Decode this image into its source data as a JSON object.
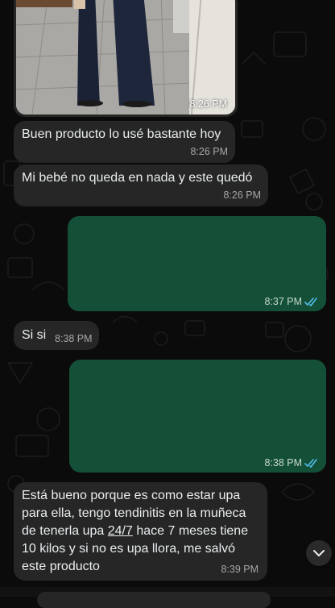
{
  "chat": {
    "photo_message": {
      "time": "8:26 PM"
    },
    "messages": [
      {
        "text": "Buen producto lo usé bastante hoy",
        "time": "8:26 PM"
      },
      {
        "text": "Mi bebé no queda en nada y este quedó",
        "time": "8:26 PM"
      },
      {
        "time": "8:37 PM",
        "status": "read"
      },
      {
        "text": "Si si",
        "time": "8:38 PM"
      },
      {
        "time": "8:38 PM",
        "status": "read"
      },
      {
        "lines": [
          "Está bueno porque es como estar upa",
          "para ella, tengo tendinitis en la muñeca",
          "de tenerla upa ",
          "24/7",
          " hace 7 meses tiene",
          "10 kilos y si no es upa llora, me salvó",
          "este producto"
        ],
        "time": "8:39 PM"
      }
    ]
  },
  "icons": {
    "read_receipt": "double-check-icon",
    "scroll_down": "chevron-down-icon"
  },
  "colors": {
    "background": "#0b0b0b",
    "incoming_bubble": "#262626",
    "outgoing_bubble": "#145037",
    "read_tick": "#53bdeb",
    "timestamp": "#a6a6a6"
  }
}
